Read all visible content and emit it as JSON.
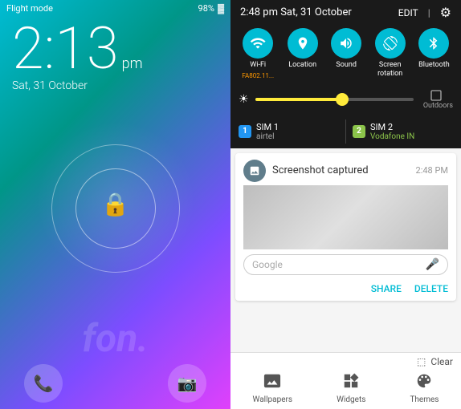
{
  "left_panel": {
    "status_bar": {
      "flight_mode": "Flight mode",
      "battery": "98%",
      "battery_icon": "🔋"
    },
    "time": {
      "hour": "2:13",
      "ampm": "pm",
      "date": "Sat, 31 October"
    },
    "lock_icon": "🔒",
    "watermark": "fon.",
    "bottom_icons": {
      "phone": "📞",
      "camera": "📷"
    }
  },
  "right_panel": {
    "header": {
      "time": "2:48 pm Sat, 31 October",
      "edit": "EDIT",
      "gear": "⚙"
    },
    "toggles": [
      {
        "id": "wifi",
        "icon": "📶",
        "label": "Wi-Fi",
        "sub": "FA802.11...",
        "active": true
      },
      {
        "id": "location",
        "icon": "📍",
        "label": "Location",
        "sub": "",
        "active": true
      },
      {
        "id": "sound",
        "icon": "🔊",
        "label": "Sound",
        "sub": "",
        "active": true
      },
      {
        "id": "rotation",
        "icon": "📱",
        "label": "Screen\nrotation",
        "sub": "",
        "active": true
      },
      {
        "id": "bluetooth",
        "icon": "✦",
        "label": "Bluetooth",
        "sub": "",
        "active": true
      }
    ],
    "brightness": {
      "icon": "☀",
      "level": 55,
      "outdoors": "Outdoors"
    },
    "sim": {
      "sim1": {
        "number": "1",
        "name": "SIM 1",
        "carrier": "airtel"
      },
      "sim2": {
        "number": "2",
        "name": "SIM 2",
        "carrier": "Vodafone IN"
      }
    },
    "notification": {
      "icon": "📷",
      "title": "Screenshot captured",
      "time": "2:48 PM",
      "search_placeholder": "Google",
      "mic_icon": "🎤",
      "actions": {
        "share": "SHARE",
        "delete": "DELETE"
      }
    },
    "bottom": {
      "clear_icon": "≡",
      "clear_label": "Clear",
      "shortcuts": [
        {
          "id": "wallpapers",
          "icon": "🖼",
          "label": "Wallpapers"
        },
        {
          "id": "widgets",
          "icon": "⊞",
          "label": "Widgets"
        },
        {
          "id": "themes",
          "icon": "◈",
          "label": "Themes"
        }
      ]
    }
  }
}
